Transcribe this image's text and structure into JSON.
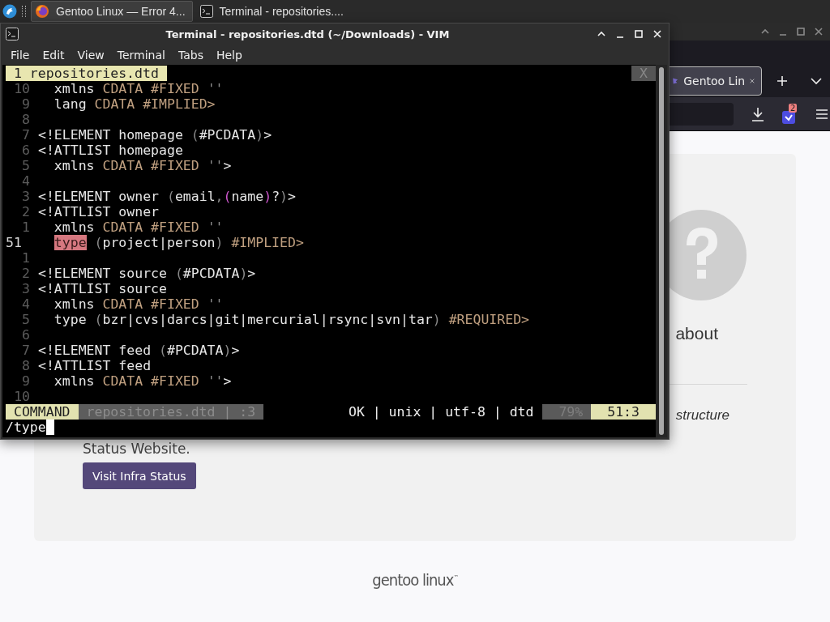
{
  "taskbar": {
    "tasks": [
      {
        "title": "Gentoo Linux — Error 4...",
        "kind": "browser",
        "selected": true
      },
      {
        "title": "Terminal - repositories....",
        "kind": "terminal",
        "selected": false
      }
    ]
  },
  "browser": {
    "tab": {
      "title": "Gentoo Lin",
      "selected": true
    },
    "extension_badge": "2",
    "page": {
      "heading": "about",
      "note": "structure",
      "paragraph": "Status Website.",
      "button": "Visit Infra Status",
      "footer_logo": "gentoo linux$^{™}$"
    }
  },
  "terminal": {
    "title": "Terminal - repositories.dtd (~/Downloads) - VIM",
    "menu": [
      "File",
      "Edit",
      "View",
      "Terminal",
      "Tabs",
      "Help"
    ],
    "vim": {
      "tabs": [
        {
          "label": "1 repositories.dtd",
          "selected": true
        }
      ],
      "close_label": "X",
      "lines": [
        {
          "number": "10",
          "current": false,
          "tokens": [
            {
              "text": "  xmlns ",
              "kind": "plain"
            },
            {
              "text": "CDATA #FIXED",
              "kind": "keyword"
            },
            {
              "text": " ''",
              "kind": "punct"
            }
          ]
        },
        {
          "number": "9",
          "current": false,
          "tokens": [
            {
              "text": "  lang ",
              "kind": "plain"
            },
            {
              "text": "CDATA #IMPLIED>",
              "kind": "keyword"
            }
          ]
        },
        {
          "number": "8",
          "current": false
        },
        {
          "number": "7",
          "current": false,
          "tokens": [
            {
              "text": "<!ELEMENT homepage ",
              "kind": "plain"
            },
            {
              "text": "(",
              "kind": "punct"
            },
            {
              "text": "#PCDATA",
              "kind": "plain"
            },
            {
              "text": ")",
              "kind": "punct"
            },
            {
              "text": ">",
              "kind": "plain"
            }
          ]
        },
        {
          "number": "6",
          "current": false,
          "tokens": [
            {
              "text": "<!ATTLIST homepage",
              "kind": "plain"
            }
          ]
        },
        {
          "number": "5",
          "current": false,
          "tokens": [
            {
              "text": "  xmlns ",
              "kind": "plain"
            },
            {
              "text": "CDATA #FIXED",
              "kind": "keyword"
            },
            {
              "text": " ''",
              "kind": "punct"
            },
            {
              "text": ">",
              "kind": "plain"
            }
          ]
        },
        {
          "number": "4",
          "current": false
        },
        {
          "number": "3",
          "current": false,
          "tokens": [
            {
              "text": "<!ELEMENT owner ",
              "kind": "plain"
            },
            {
              "text": "(",
              "kind": "punct"
            },
            {
              "text": "email",
              "kind": "plain"
            },
            {
              "text": ",",
              "kind": "punct"
            },
            {
              "text": "(",
              "kind": "match"
            },
            {
              "text": "name",
              "kind": "plain"
            },
            {
              "text": ")",
              "kind": "match"
            },
            {
              "text": "?",
              "kind": "plain"
            },
            {
              "text": ")",
              "kind": "punct"
            },
            {
              "text": ">",
              "kind": "plain"
            }
          ]
        },
        {
          "number": "2",
          "current": false,
          "tokens": [
            {
              "text": "<!ATTLIST owner",
              "kind": "plain"
            }
          ]
        },
        {
          "number": "1",
          "current": false,
          "tokens": [
            {
              "text": "  xmlns ",
              "kind": "plain"
            },
            {
              "text": "CDATA #FIXED",
              "kind": "keyword"
            },
            {
              "text": " ''",
              "kind": "punct"
            }
          ]
        },
        {
          "number": "51",
          "current": true,
          "tokens": [
            {
              "kind": "indent"
            },
            {
              "text": "type",
              "kind": "search"
            },
            {
              "text": " (",
              "kind": "punct"
            },
            {
              "text": "project|person",
              "kind": "plain"
            },
            {
              "text": ") ",
              "kind": "punct"
            },
            {
              "text": "#IMPLIED>",
              "kind": "keyword"
            }
          ]
        },
        {
          "number": "1",
          "current": false
        },
        {
          "number": "2",
          "current": false,
          "tokens": [
            {
              "text": "<!ELEMENT source ",
              "kind": "plain"
            },
            {
              "text": "(",
              "kind": "punct"
            },
            {
              "text": "#PCDATA",
              "kind": "plain"
            },
            {
              "text": ")",
              "kind": "punct"
            },
            {
              "text": ">",
              "kind": "plain"
            }
          ]
        },
        {
          "number": "3",
          "current": false,
          "tokens": [
            {
              "text": "<!ATTLIST source",
              "kind": "plain"
            }
          ]
        },
        {
          "number": "4",
          "current": false,
          "tokens": [
            {
              "text": "  xmlns ",
              "kind": "plain"
            },
            {
              "text": "CDATA #FIXED",
              "kind": "keyword"
            },
            {
              "text": " ''",
              "kind": "punct"
            }
          ]
        },
        {
          "number": "5",
          "current": false,
          "tokens": [
            {
              "text": "  type ",
              "kind": "plain"
            },
            {
              "text": "(",
              "kind": "punct"
            },
            {
              "text": "bzr|cvs|darcs|git|mercurial|rsync|svn|tar",
              "kind": "plain"
            },
            {
              "text": ") ",
              "kind": "punct"
            },
            {
              "text": "#REQUIRED>",
              "kind": "keyword"
            }
          ]
        },
        {
          "number": "6",
          "current": false
        },
        {
          "number": "7",
          "current": false,
          "tokens": [
            {
              "text": "<!ELEMENT feed ",
              "kind": "plain"
            },
            {
              "text": "(",
              "kind": "punct"
            },
            {
              "text": "#PCDATA",
              "kind": "plain"
            },
            {
              "text": ")",
              "kind": "punct"
            },
            {
              "text": ">",
              "kind": "plain"
            }
          ]
        },
        {
          "number": "8",
          "current": false,
          "tokens": [
            {
              "text": "<!ATTLIST feed",
              "kind": "plain"
            }
          ]
        },
        {
          "number": "9",
          "current": false,
          "tokens": [
            {
              "text": "  xmlns ",
              "kind": "plain"
            },
            {
              "text": "CDATA #FIXED",
              "kind": "keyword"
            },
            {
              "text": " ''",
              "kind": "punct"
            },
            {
              "text": ">",
              "kind": "plain"
            }
          ]
        },
        {
          "number": "10",
          "current": false
        }
      ],
      "status": {
        "mode": "COMMAND",
        "file": "repositories.dtd | :3",
        "info": "OK | unix | utf-8 | dtd",
        "percent": "79%",
        "position": "51:3"
      },
      "command": "/type"
    }
  }
}
